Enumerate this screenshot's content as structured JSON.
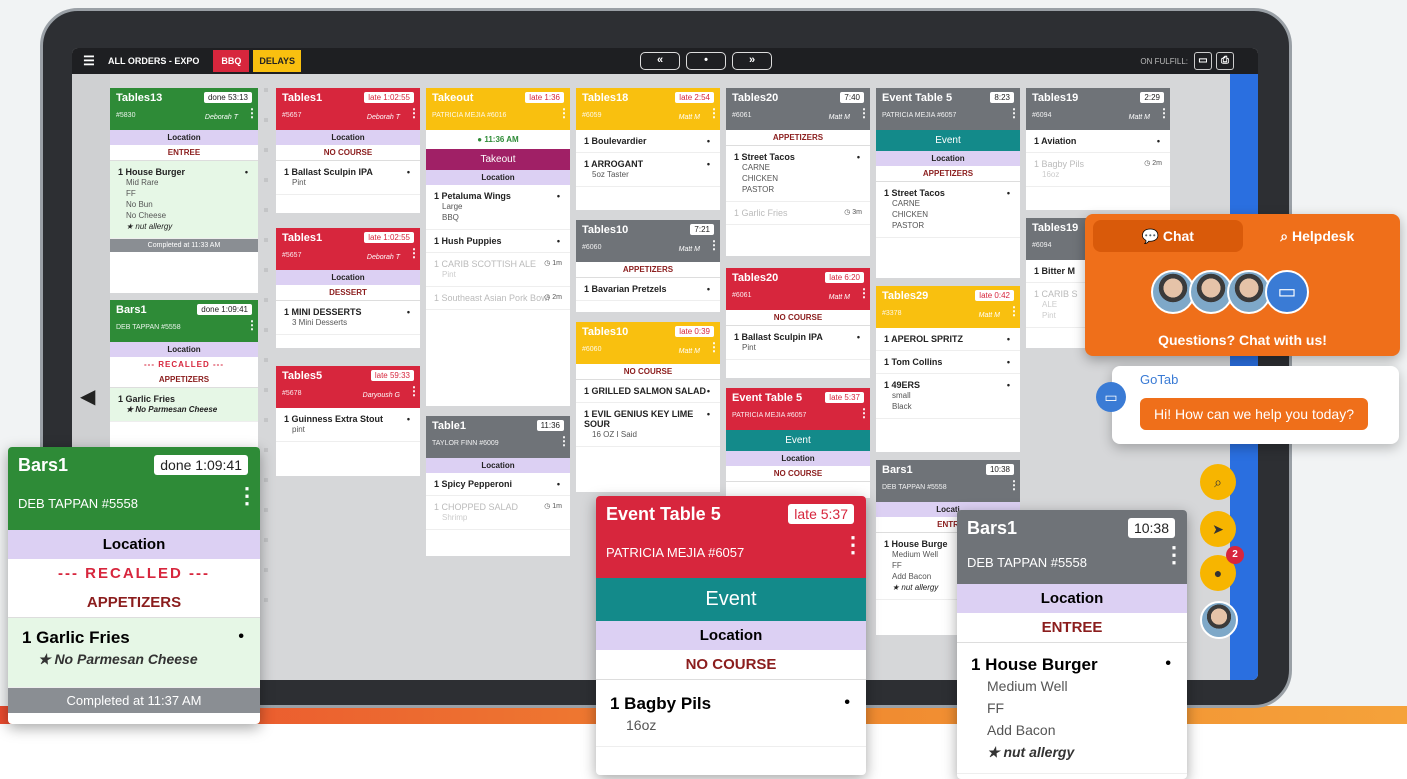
{
  "topbar": {
    "title": "ALL ORDERS - EXPO",
    "bbq": "BBQ",
    "delays": "DELAYS",
    "prev": "«",
    "mid": "•",
    "next": "»",
    "on_fulfill": "ON FULFILL:"
  },
  "tickets": {
    "t1": {
      "name": "Tables13",
      "badge": "done 53:13",
      "num": "#5830",
      "server": "Deborah T",
      "loc": "Location",
      "course": "ENTREE",
      "item": "1  House Burger",
      "mods": [
        "Mid Rare",
        "FF",
        "No Bun",
        "No Cheese"
      ],
      "allergy": "★ nut allergy",
      "completed": "Completed at 11:33 AM"
    },
    "t2": {
      "name": "Bars1",
      "badge": "done 1:09:41",
      "sub": "DEB TAPPAN #5558",
      "loc": "Location",
      "recall": "--- RECALLED ---",
      "course": "APPETIZERS",
      "item": "1  Garlic Fries",
      "note": "★ No Parmesan Cheese"
    },
    "t3": {
      "name": "Tables1",
      "badge": "late 1:02:55",
      "num": "#5657",
      "server": "Deborah T",
      "loc": "Location",
      "course": "NO COURSE",
      "item": "1  Ballast Sculpin IPA",
      "mod": "Pint"
    },
    "t4": {
      "name": "Tables1",
      "badge": "late 1:02:55",
      "num": "#5657",
      "server": "Deborah T",
      "loc": "Location",
      "course": "DESSERT",
      "item": "1  MINI DESSERTS",
      "mod": "3 Mini Desserts"
    },
    "t5": {
      "name": "Tables5",
      "badge": "late 59:33",
      "num": "#5678",
      "server": "Daryoush G",
      "item": "1  Guinness Extra Stout",
      "mod": "pint"
    },
    "t6": {
      "name": "Takeout",
      "badge": "late 1:36",
      "sub": "PATRICIA MEJIA #6016",
      "time": "11:36 AM",
      "bar": "Takeout",
      "loc": "Location",
      "i1": "1  Petaluma Wings",
      "i1m": [
        "Large",
        "BBQ"
      ],
      "i2": "1  Hush Puppies",
      "i3": "1  CARIB SCOTTISH ALE",
      "i3m": "Pint",
      "i3t": "1m",
      "i4": "1  Southeast Asian Pork Bowl",
      "i4t": "2m"
    },
    "t7": {
      "name": "Table1",
      "badge": "11:36",
      "sub": "TAYLOR FINN #6009",
      "loc": "Location",
      "i1": "1  Spicy Pepperoni",
      "i2": "1  CHOPPED SALAD",
      "i2m": "Shrimp",
      "i2t": "1m"
    },
    "t8": {
      "name": "Tables18",
      "badge": "late 2:54",
      "num": "#6059",
      "server": "Matt M",
      "i1": "1  Boulevardier",
      "i2": "1  ARROGANT",
      "i2m": "5oz Taster"
    },
    "t9": {
      "name": "Tables10",
      "badge": "7:21",
      "num": "#6060",
      "server": "Matt M",
      "course": "APPETIZERS",
      "i1": "1  Bavarian Pretzels"
    },
    "t10": {
      "name": "Tables10",
      "badge": "late 0:39",
      "num": "#6060",
      "server": "Matt M",
      "course": "NO COURSE",
      "i1": "1  GRILLED SALMON SALAD",
      "i2": "1  EVIL GENIUS KEY LIME SOUR",
      "i2m": "16 OZ I Said"
    },
    "t11": {
      "name": "Tables20",
      "badge": "7:40",
      "num": "#6061",
      "server": "Matt M",
      "course": "APPETIZERS",
      "i1": "1  Street Tacos",
      "i1m": [
        "CARNE",
        "CHICKEN",
        "PASTOR"
      ],
      "i2": "1  Garlic Fries",
      "i2t": "3m"
    },
    "t12": {
      "name": "Tables20",
      "badge": "late 6:20",
      "num": "#6061",
      "server": "Matt M",
      "course": "NO COURSE",
      "i1": "1  Ballast Sculpin IPA",
      "i1m": "Pint"
    },
    "t13": {
      "name": "Event Table 5",
      "badge": "late 5:37",
      "sub": "PATRICIA MEJIA #6057",
      "bar": "Event",
      "loc": "Location",
      "course": "NO COURSE"
    },
    "t14": {
      "name": "Event Table 5",
      "badge": "8:23",
      "sub": "PATRICIA MEJIA #6057",
      "bar": "Event",
      "loc": "Location",
      "course": "APPETIZERS",
      "i1": "1  Street Tacos",
      "i1m": [
        "CARNE",
        "CHICKEN",
        "PASTOR"
      ]
    },
    "t15": {
      "name": "Tables29",
      "badge": "late 0:42",
      "num": "#3378",
      "server": "Matt M",
      "i1": "1  APEROL SPRITZ",
      "i2": "1  Tom Collins",
      "i3": "1  49ERS",
      "i3m": [
        "small",
        "Black"
      ]
    },
    "t16": {
      "name": "Bars1",
      "badge": "10:38",
      "sub": "DEB TAPPAN #5558",
      "loc": "Locati",
      "course": "ENTR",
      "i1": "1  House Burge",
      "i1m": [
        "Medium Well",
        "FF",
        "Add Bacon"
      ],
      "allergy": "★ nut allergy"
    },
    "t17": {
      "name": "Tables19",
      "badge": "2:29",
      "num": "#6094",
      "server": "Matt M",
      "i1": "1  Aviation",
      "i2": "1  Bagby Pils",
      "i2m": "16oz",
      "i2t": "2m"
    },
    "t18": {
      "name": "Tables19",
      "num": "#6094",
      "i1": "1  Bitter M",
      "i2": "1  CARIB S",
      "i2m": [
        "ALE",
        "Pint"
      ]
    }
  },
  "big_left": {
    "name": "Bars1",
    "badge": "done 1:09:41",
    "sub": "DEB TAPPAN #5558",
    "loc": "Location",
    "recall": "--- RECALLED ---",
    "course": "APPETIZERS",
    "item": "1  Garlic Fries",
    "note": "★ No Parmesan Cheese",
    "completed": "Completed at 11:37 AM"
  },
  "big_mid": {
    "name": "Event Table 5",
    "badge": "late 5:37",
    "sub": "PATRICIA MEJIA #6057",
    "bar": "Event",
    "loc": "Location",
    "course": "NO COURSE",
    "item": "1  Bagby Pils",
    "mod": "16oz"
  },
  "big_right": {
    "name": "Bars1",
    "badge": "10:38",
    "sub": "DEB TAPPAN #5558",
    "loc": "Location",
    "course": "ENTREE",
    "item": "1  House Burger",
    "mods": [
      "Medium Well",
      "FF",
      "Add Bacon"
    ],
    "allergy": "★ nut allergy"
  },
  "chat": {
    "tab_chat": "Chat",
    "tab_help": "Helpdesk",
    "questions": "Questions? Chat with us!",
    "brand": "GoTab",
    "message": "Hi! How can we help you today?",
    "badge_count": "2"
  },
  "colors": {
    "green": "#2e8b37",
    "red": "#d7263d",
    "yellow": "#f9c00f",
    "gray": "#6f7378",
    "teal": "#0f8a8a",
    "purple": "#dcd0f3",
    "orange": "#ef6f1a",
    "blue": "#2a6fe0"
  },
  "icons": [
    "menu-icon",
    "search-icon",
    "cursor-icon",
    "chat-icon",
    "print-icon",
    "user-icon",
    "left-arrow-icon"
  ]
}
